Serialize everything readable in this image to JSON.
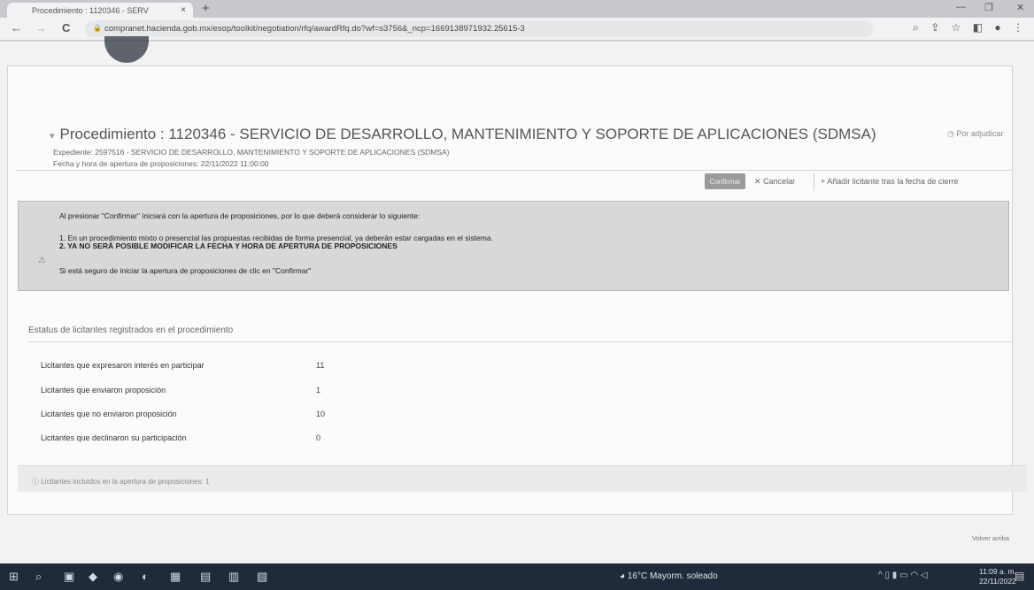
{
  "browser": {
    "tab_title": "Procedimiento : 1120346 - SERV",
    "tab_close": "×",
    "new_tab": "+",
    "url": "compranet.hacienda.gob.mx/esop/toolkit/negotiation/rfq/awardRfq.do?wf=s3756&_ncp=1669138971932.25615-3",
    "window_controls": {
      "minimize": "—",
      "restore": "❐",
      "close": "✕"
    },
    "nav": {
      "back": "←",
      "forward": "→",
      "reload": "C"
    }
  },
  "procedure": {
    "title": "Procedimiento : 1120346 - SERVICIO DE DESARROLLO, MANTENIMIENTO Y SOPORTE DE APLICACIONES (SDMSA)",
    "status": "Por adjudicar",
    "expediente": "Expediente: 2597516 - SERVICIO DE DESARROLLO, MANTENIMIENTO Y SOPORTE DE APLICACIONES (SDMSA)",
    "fecha": "Fecha y hora de apertura de proposiciones: 22/11/2022 11:00:00"
  },
  "toolbar": {
    "confirm_label": "Confirmar",
    "cancel_label": "Cancelar",
    "add_bidder_label": "Añadir licitante tras la fecha de cierre"
  },
  "alert": {
    "intro": "Al presionar \"Confirmar\" iniciará con la apertura de proposiciones, por lo que deberá considerar lo siguiente:",
    "item1": "1. En un procedimiento mixto o presencial las propuestas recibidas de forma presencial, ya deberán estar cargadas en el sistema.",
    "item2": "2. YA NO SERÁ POSIBLE MODIFICAR LA FECHA Y HORA DE APERTURA DE PROPOSICIONES",
    "closing": "Si está seguro de iniciar la apertura de proposiciones de clic en \"Confirmar\""
  },
  "bidders": {
    "heading": "Estatus de licitantes registrados en el procedimiento",
    "rows": [
      {
        "label": "Licitantes que expresaron interés en participar",
        "value": "11"
      },
      {
        "label": "Licitantes que enviaron proposición",
        "value": "1"
      },
      {
        "label": "Licitantes que no enviaron proposición",
        "value": "10"
      },
      {
        "label": "Licitantes que declinaron su participación",
        "value": "0"
      }
    ]
  },
  "footer": {
    "note": "Licitantes incluidos en la apertura de proposiciones: 1",
    "back_to_top": "Volver arriba"
  },
  "taskbar": {
    "weather": "16°C Mayorm. soleado",
    "time": "11:09 a. m.",
    "date": "22/11/2022"
  }
}
